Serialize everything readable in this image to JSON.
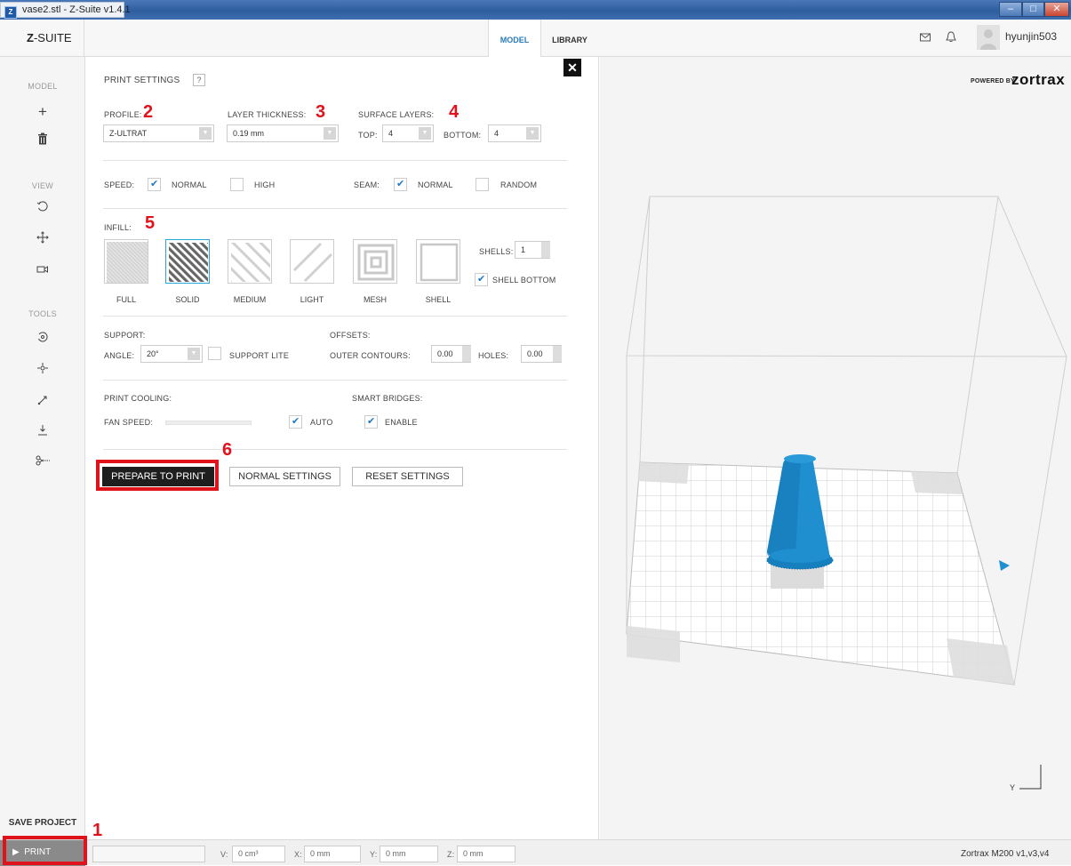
{
  "window": {
    "title": "vase2.stl - Z-Suite v1.4.1",
    "app_icon": "Z"
  },
  "topbar": {
    "logo_prefix": "Z",
    "logo_rest": "-SUITE",
    "tabs": [
      {
        "label": "MODEL",
        "active": true
      },
      {
        "label": "LIBRARY",
        "active": false
      }
    ],
    "username": "hyunjin503",
    "icons": [
      "mail-icon",
      "bell-icon",
      "avatar"
    ]
  },
  "sidebar": {
    "sections": [
      {
        "label": "MODEL",
        "icons": [
          "plus-icon",
          "trash-icon"
        ]
      },
      {
        "label": "VIEW",
        "icons": [
          "rotate-view-icon",
          "pan-icon",
          "camera-icon"
        ]
      },
      {
        "label": "TOOLS",
        "icons": [
          "rotate-tool-icon",
          "move-tool-icon",
          "scale-icon",
          "drop-icon",
          "cut-icon"
        ]
      }
    ],
    "save_project": "SAVE PROJECT",
    "print": "PRINT"
  },
  "settings": {
    "title": "PRINT SETTINGS",
    "help": "?",
    "profile_label": "PROFILE:",
    "profile_value": "Z-ULTRAT",
    "layer_label": "LAYER THICKNESS:",
    "layer_value": "0.19 mm",
    "surface_label": "SURFACE LAYERS:",
    "top_label": "TOP:",
    "top_value": "4",
    "bottom_label": "BOTTOM:",
    "bottom_value": "4",
    "speed_label": "SPEED:",
    "speed_normal": "NORMAL",
    "speed_high": "HIGH",
    "seam_label": "SEAM:",
    "seam_normal": "NORMAL",
    "seam_random": "RANDOM",
    "infill_label": "INFILL:",
    "infill_options": [
      "FULL",
      "SOLID",
      "MEDIUM",
      "LIGHT",
      "MESH",
      "SHELL"
    ],
    "infill_selected": "SOLID",
    "shells_label": "SHELLS:",
    "shells_value": "1",
    "shell_bottom": "SHELL BOTTOM",
    "support_label": "SUPPORT:",
    "angle_label": "ANGLE:",
    "angle_value": "20°",
    "support_lite": "SUPPORT LITE",
    "offsets_label": "OFFSETS:",
    "outer_label": "OUTER CONTOURS:",
    "outer_value": "0.00",
    "holes_label": "HOLES:",
    "holes_value": "0.00",
    "cooling_label": "PRINT COOLING:",
    "fan_label": "FAN SPEED:",
    "fan_auto": "AUTO",
    "bridges_label": "SMART BRIDGES:",
    "bridges_enable": "ENABLE",
    "prepare_button": "PREPARE TO PRINT",
    "normal_button": "NORMAL SETTINGS",
    "reset_button": "RESET SETTINGS"
  },
  "annotations": [
    "1",
    "2",
    "3",
    "4",
    "5",
    "6"
  ],
  "viewport": {
    "powered_by": "POWERED BY",
    "brand": "zortrax",
    "axis_y": "Y",
    "accent": "#1f8fd0"
  },
  "statusbar": {
    "v_label": "V:",
    "v_value": "0 cm³",
    "x_label": "X:",
    "x_value": "0 mm",
    "y_label": "Y:",
    "y_value": "0 mm",
    "z_label": "Z:",
    "z_value": "0 mm",
    "printer": "Zortrax M200 v1,v3,v4"
  }
}
